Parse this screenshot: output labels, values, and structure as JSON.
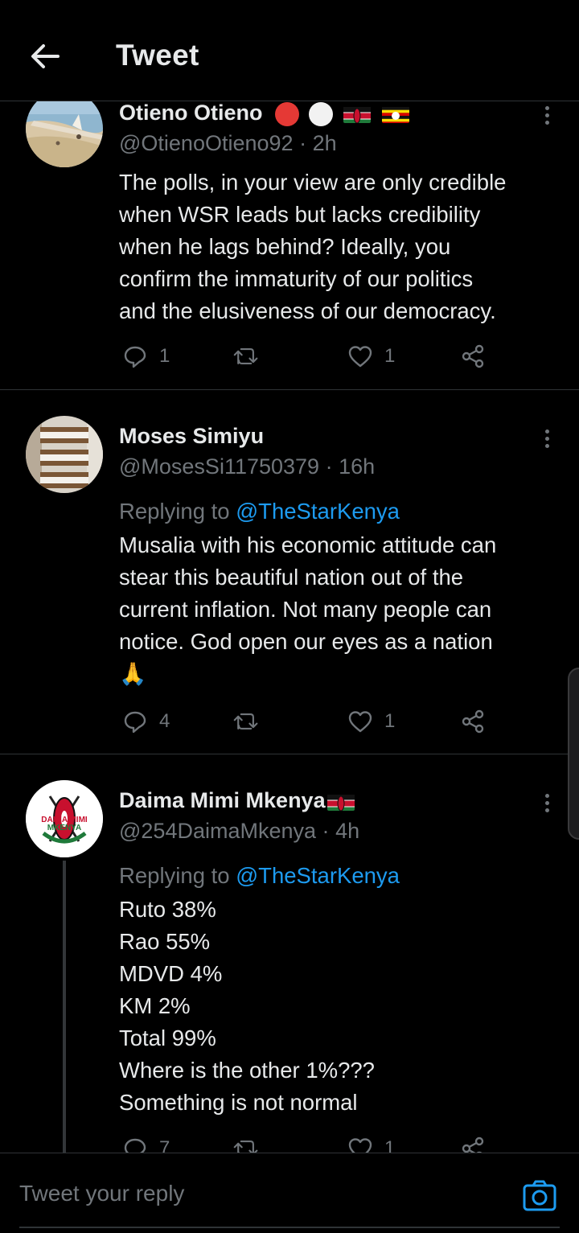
{
  "header": {
    "title": "Tweet"
  },
  "tweets": [
    {
      "name": "Otieno Otieno",
      "handle": "@OtienoOtieno92",
      "time": "2h",
      "text_lines": [
        "The polls, in your view are only credible",
        "when WSR leads but lacks credibility",
        "when he lags behind? Ideally, you",
        "confirm the immaturity of our politics",
        "and the elusiveness of our democracy."
      ],
      "replies": "1",
      "retweets": "",
      "likes": "1"
    },
    {
      "name": "Moses Simiyu",
      "handle": "@MosesSi11750379",
      "time": "16h",
      "replying_label": "Replying to",
      "replying_to": "@TheStarKenya",
      "text_lines": [
        "Musalia with his economic attitude can",
        "stear this beautiful nation out of the",
        "current inflation. Not many people can",
        "notice. God open our eyes as a nation",
        "🙏"
      ],
      "replies": "4",
      "retweets": "",
      "likes": "1"
    },
    {
      "name": "Daima Mimi Mkenya",
      "handle": "@254DaimaMkenya",
      "time": "4h",
      "avatar_text_top": "DAIMA MIMI",
      "avatar_text_bottom": "MKENYA",
      "replying_label": "Replying to",
      "replying_to": "@TheStarKenya",
      "text_lines": [
        "Ruto 38%",
        "Rao 55%",
        "MDVD 4%",
        "KM 2%",
        "Total 99%",
        "Where is the other 1%???",
        "Something is not normal"
      ],
      "replies": "7",
      "retweets": "",
      "likes": "1"
    }
  ],
  "reply_bar": {
    "placeholder": "Tweet your reply"
  },
  "separator": "·",
  "colors": {
    "background": "#000000",
    "text": "#e7e9ea",
    "secondary_text": "#71767b",
    "link": "#1d9bf0",
    "divider": "#2f3336"
  },
  "icons": [
    "back-arrow-icon",
    "more-vertical-icon",
    "reply-icon",
    "retweet-icon",
    "like-icon",
    "share-icon",
    "camera-icon"
  ]
}
